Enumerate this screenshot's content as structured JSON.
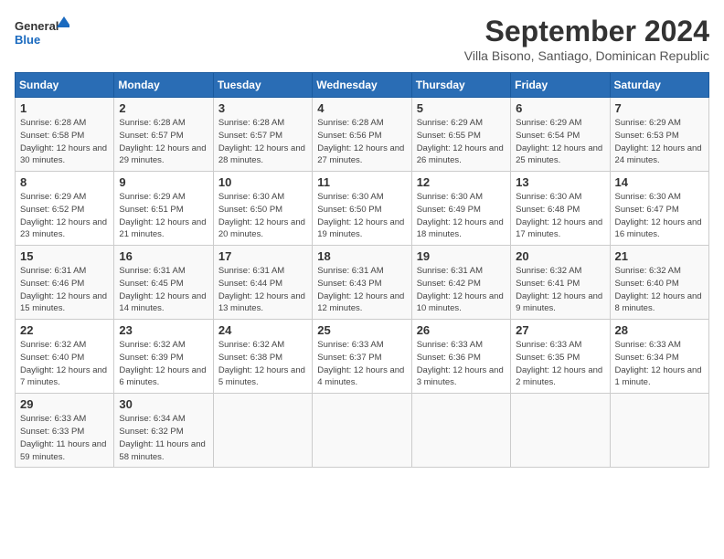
{
  "logo": {
    "general": "General",
    "blue": "Blue"
  },
  "title": "September 2024",
  "subtitle": "Villa Bisono, Santiago, Dominican Republic",
  "weekdays": [
    "Sunday",
    "Monday",
    "Tuesday",
    "Wednesday",
    "Thursday",
    "Friday",
    "Saturday"
  ],
  "weeks": [
    [
      {
        "day": 1,
        "sunrise": "6:28 AM",
        "sunset": "6:58 PM",
        "daylight": "12 hours and 30 minutes."
      },
      {
        "day": 2,
        "sunrise": "6:28 AM",
        "sunset": "6:57 PM",
        "daylight": "12 hours and 29 minutes."
      },
      {
        "day": 3,
        "sunrise": "6:28 AM",
        "sunset": "6:57 PM",
        "daylight": "12 hours and 28 minutes."
      },
      {
        "day": 4,
        "sunrise": "6:28 AM",
        "sunset": "6:56 PM",
        "daylight": "12 hours and 27 minutes."
      },
      {
        "day": 5,
        "sunrise": "6:29 AM",
        "sunset": "6:55 PM",
        "daylight": "12 hours and 26 minutes."
      },
      {
        "day": 6,
        "sunrise": "6:29 AM",
        "sunset": "6:54 PM",
        "daylight": "12 hours and 25 minutes."
      },
      {
        "day": 7,
        "sunrise": "6:29 AM",
        "sunset": "6:53 PM",
        "daylight": "12 hours and 24 minutes."
      }
    ],
    [
      {
        "day": 8,
        "sunrise": "6:29 AM",
        "sunset": "6:52 PM",
        "daylight": "12 hours and 23 minutes."
      },
      {
        "day": 9,
        "sunrise": "6:29 AM",
        "sunset": "6:51 PM",
        "daylight": "12 hours and 21 minutes."
      },
      {
        "day": 10,
        "sunrise": "6:30 AM",
        "sunset": "6:50 PM",
        "daylight": "12 hours and 20 minutes."
      },
      {
        "day": 11,
        "sunrise": "6:30 AM",
        "sunset": "6:50 PM",
        "daylight": "12 hours and 19 minutes."
      },
      {
        "day": 12,
        "sunrise": "6:30 AM",
        "sunset": "6:49 PM",
        "daylight": "12 hours and 18 minutes."
      },
      {
        "day": 13,
        "sunrise": "6:30 AM",
        "sunset": "6:48 PM",
        "daylight": "12 hours and 17 minutes."
      },
      {
        "day": 14,
        "sunrise": "6:30 AM",
        "sunset": "6:47 PM",
        "daylight": "12 hours and 16 minutes."
      }
    ],
    [
      {
        "day": 15,
        "sunrise": "6:31 AM",
        "sunset": "6:46 PM",
        "daylight": "12 hours and 15 minutes."
      },
      {
        "day": 16,
        "sunrise": "6:31 AM",
        "sunset": "6:45 PM",
        "daylight": "12 hours and 14 minutes."
      },
      {
        "day": 17,
        "sunrise": "6:31 AM",
        "sunset": "6:44 PM",
        "daylight": "12 hours and 13 minutes."
      },
      {
        "day": 18,
        "sunrise": "6:31 AM",
        "sunset": "6:43 PM",
        "daylight": "12 hours and 12 minutes."
      },
      {
        "day": 19,
        "sunrise": "6:31 AM",
        "sunset": "6:42 PM",
        "daylight": "12 hours and 10 minutes."
      },
      {
        "day": 20,
        "sunrise": "6:32 AM",
        "sunset": "6:41 PM",
        "daylight": "12 hours and 9 minutes."
      },
      {
        "day": 21,
        "sunrise": "6:32 AM",
        "sunset": "6:40 PM",
        "daylight": "12 hours and 8 minutes."
      }
    ],
    [
      {
        "day": 22,
        "sunrise": "6:32 AM",
        "sunset": "6:40 PM",
        "daylight": "12 hours and 7 minutes."
      },
      {
        "day": 23,
        "sunrise": "6:32 AM",
        "sunset": "6:39 PM",
        "daylight": "12 hours and 6 minutes."
      },
      {
        "day": 24,
        "sunrise": "6:32 AM",
        "sunset": "6:38 PM",
        "daylight": "12 hours and 5 minutes."
      },
      {
        "day": 25,
        "sunrise": "6:33 AM",
        "sunset": "6:37 PM",
        "daylight": "12 hours and 4 minutes."
      },
      {
        "day": 26,
        "sunrise": "6:33 AM",
        "sunset": "6:36 PM",
        "daylight": "12 hours and 3 minutes."
      },
      {
        "day": 27,
        "sunrise": "6:33 AM",
        "sunset": "6:35 PM",
        "daylight": "12 hours and 2 minutes."
      },
      {
        "day": 28,
        "sunrise": "6:33 AM",
        "sunset": "6:34 PM",
        "daylight": "12 hours and 1 minute."
      }
    ],
    [
      {
        "day": 29,
        "sunrise": "6:33 AM",
        "sunset": "6:33 PM",
        "daylight": "11 hours and 59 minutes."
      },
      {
        "day": 30,
        "sunrise": "6:34 AM",
        "sunset": "6:32 PM",
        "daylight": "11 hours and 58 minutes."
      },
      null,
      null,
      null,
      null,
      null
    ]
  ]
}
